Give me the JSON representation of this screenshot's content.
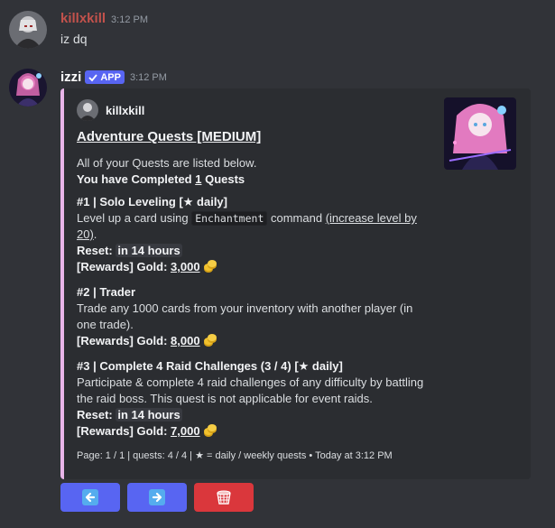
{
  "messages": [
    {
      "author": "killxkill",
      "author_color": "#c2524c",
      "time": "3:12 PM",
      "text": "iz dq"
    },
    {
      "author": "izzi",
      "author_color": "#ffffff",
      "badge": "APP",
      "time": "3:12 PM"
    }
  ],
  "embed": {
    "accent_color": "#e8b4e8",
    "author": "killxkill",
    "title": "Adventure Quests [MEDIUM]",
    "intro_line": "All of your Quests are listed below.",
    "completed_prefix": "You have Completed ",
    "completed_count": "1",
    "completed_suffix": " Quests",
    "quests": [
      {
        "header": "#1 | Solo Leveling [★ daily]",
        "desc_before": "Level up a card using ",
        "desc_code": "Enchantment",
        "desc_after": " command ",
        "desc_link": "(increase level by 20)",
        "desc_end": ".",
        "reset_label": "Reset:",
        "reset_value": "in 14 hours",
        "rewards_label": "[Rewards] Gold: ",
        "rewards_value": "3,000"
      },
      {
        "header": "#2 | Trader",
        "desc": "Trade any 1000 cards from your inventory with another player (in one trade).",
        "rewards_label": "[Rewards] Gold: ",
        "rewards_value": "8,000"
      },
      {
        "header": "#3 | Complete 4 Raid Challenges (3 / 4) [★ daily]",
        "desc": "Participate & complete 4 raid challenges of any difficulty by battling the raid boss. This quest is not applicable for event raids.",
        "reset_label": "Reset:",
        "reset_value": "in 14 hours",
        "rewards_label": "[Rewards] Gold: ",
        "rewards_value": "7,000"
      }
    ],
    "footer": "Page: 1 / 1 | quests: 4 / 4 | ★ = daily / weekly quests • Today at 3:12 PM"
  },
  "buttons": [
    {
      "icon": "arrow-left-icon",
      "color": "#5865f2"
    },
    {
      "icon": "arrow-right-icon",
      "color": "#5865f2"
    },
    {
      "icon": "wastebasket-icon",
      "color": "#da373c"
    }
  ]
}
